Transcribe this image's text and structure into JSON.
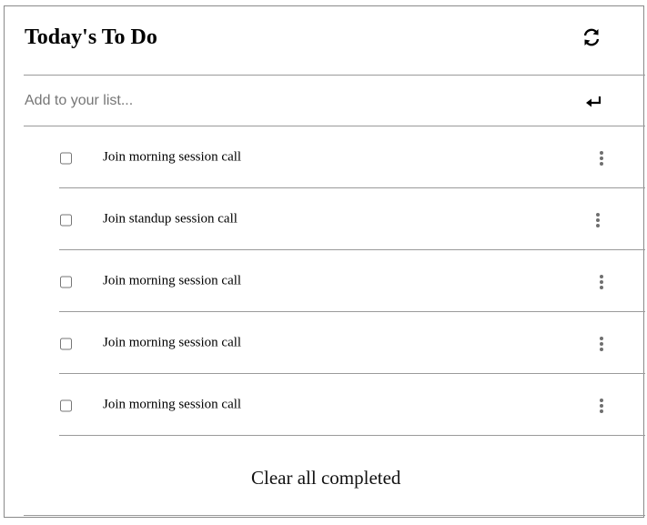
{
  "header": {
    "title": "Today's To Do",
    "refresh_icon": "refresh-icon"
  },
  "add": {
    "placeholder": "Add to your list...",
    "value": "",
    "enter_icon": "enter-return-icon"
  },
  "todos": [
    {
      "label": "Join morning session call",
      "checked": false,
      "menu_icon": "more-vertical-icon"
    },
    {
      "label": "Join standup session call",
      "checked": false,
      "menu_icon": "more-vertical-icon"
    },
    {
      "label": "Join morning session call",
      "checked": false,
      "menu_icon": "more-vertical-icon"
    },
    {
      "label": "Join morning session call",
      "checked": false,
      "menu_icon": "more-vertical-icon"
    },
    {
      "label": "Join morning session call",
      "checked": false,
      "menu_icon": "more-vertical-icon"
    }
  ],
  "footer": {
    "clear_label": "Clear all completed"
  },
  "colors": {
    "divider": "#9a9a9a",
    "frame": "#8a8a8a",
    "menu_dots": "#6f6f6f",
    "placeholder": "#767676"
  }
}
